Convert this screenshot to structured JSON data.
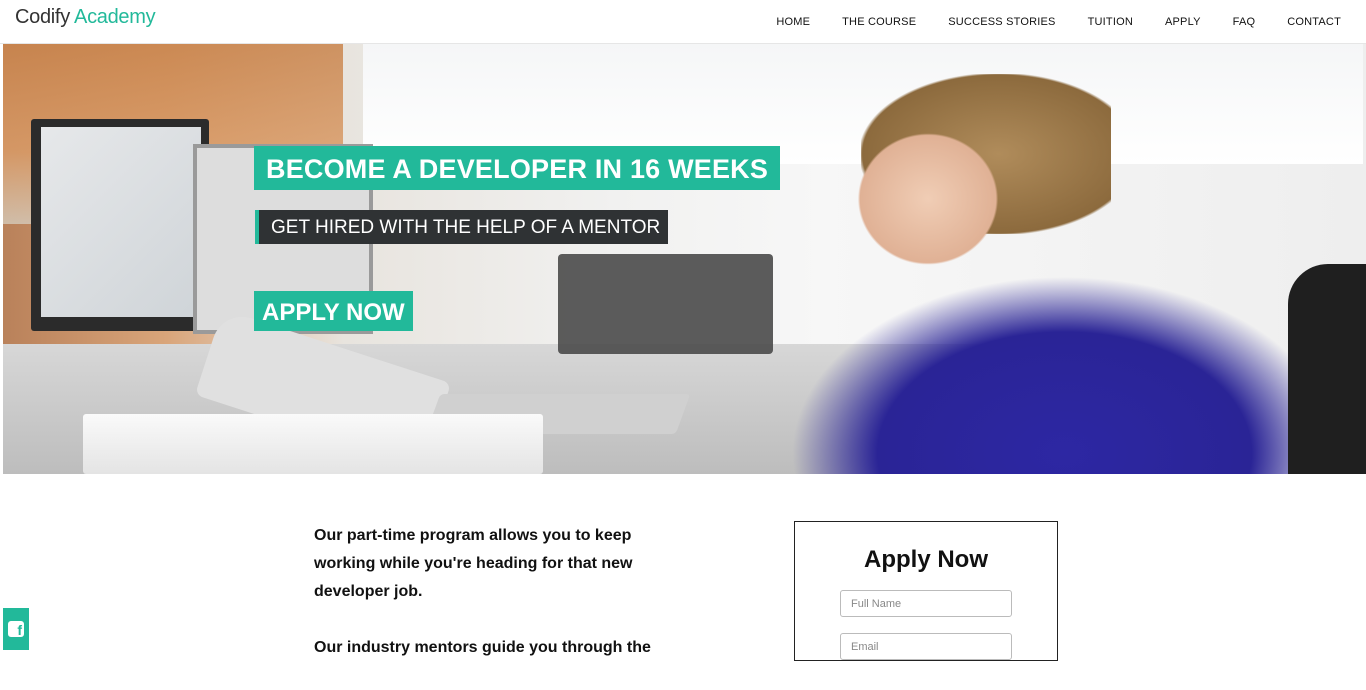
{
  "brand": {
    "part1": "Codify",
    "part2": "Academy"
  },
  "nav": {
    "items": [
      "HOME",
      "THE COURSE",
      "SUCCESS STORIES",
      "TUITION",
      "APPLY",
      "FAQ",
      "CONTACT"
    ]
  },
  "hero": {
    "headline": "BECOME A DEVELOPER IN 16 WEEKS",
    "subline": "GET HIRED WITH THE HELP OF A MENTOR",
    "cta": "APPLY NOW"
  },
  "content": {
    "paragraph1": "Our part-time program allows you to keep working while you're heading for that new developer job.",
    "paragraph2": "Our industry mentors guide you through the"
  },
  "form": {
    "title": "Apply Now",
    "full_name_placeholder": "Full Name",
    "email_placeholder": "Email"
  },
  "colors": {
    "accent": "#22b99a",
    "dark": "#2f3234"
  },
  "icons": {
    "social": "facebook-icon"
  }
}
